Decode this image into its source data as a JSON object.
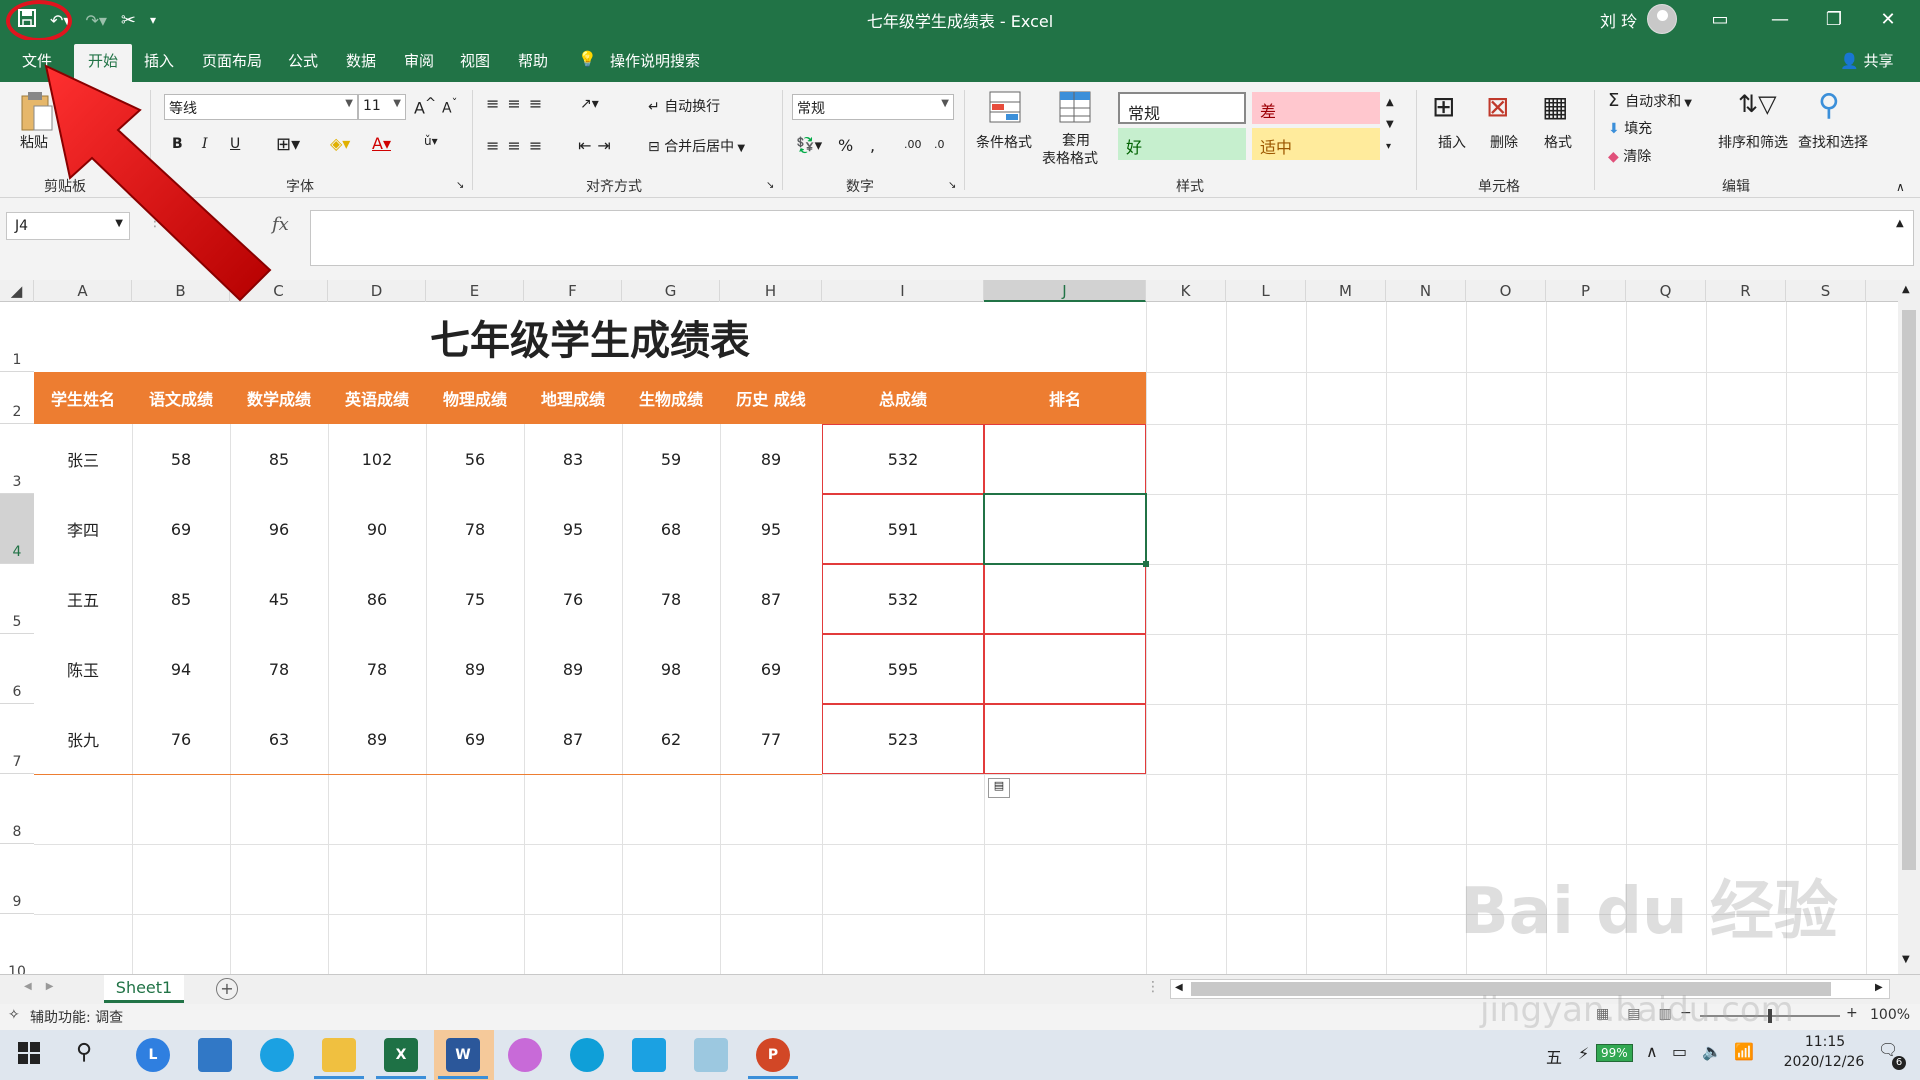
{
  "window": {
    "title": "七年级学生成绩表 - Excel",
    "user": "刘 玲"
  },
  "tabs": [
    "文件",
    "开始",
    "插入",
    "页面布局",
    "公式",
    "数据",
    "审阅",
    "视图",
    "帮助",
    "操作说明搜索"
  ],
  "active_tab": "开始",
  "share_label": "共享",
  "ribbon": {
    "clipboard": {
      "paste": "粘贴",
      "label": "剪贴板"
    },
    "font": {
      "name": "等线",
      "size": "11",
      "label": "字体",
      "bold": "B",
      "italic": "I",
      "underline": "U"
    },
    "align": {
      "wrap": "自动换行",
      "merge": "合并后居中",
      "label": "对齐方式"
    },
    "number": {
      "format": "常规",
      "percent": "%",
      "label": "数字"
    },
    "styles": {
      "conditional": "条件格式",
      "table_line1": "套用",
      "table_line2": "表格格式",
      "normal": "常规",
      "bad": "差",
      "good": "好",
      "neutral": "适中",
      "label": "样式"
    },
    "cells": {
      "insert": "插入",
      "delete": "删除",
      "format": "格式",
      "label": "单元格"
    },
    "editing": {
      "autosum": "自动求和",
      "fill": "填充",
      "clear": "清除",
      "sort": "排序和筛选",
      "find": "查找和选择",
      "label": "编辑"
    }
  },
  "namebox": "J4",
  "fx": "fx",
  "columns": [
    "A",
    "B",
    "C",
    "D",
    "E",
    "F",
    "G",
    "H",
    "I",
    "J",
    "K",
    "L",
    "M",
    "N",
    "O",
    "P",
    "Q",
    "R",
    "S"
  ],
  "rows": [
    "1",
    "2",
    "3",
    "4",
    "5",
    "6",
    "7",
    "8",
    "9",
    "10"
  ],
  "sheet": {
    "title": "七年级学生成绩表",
    "headers": [
      "学生姓名",
      "语文成绩",
      "数学成绩",
      "英语成绩",
      "物理成绩",
      "地理成绩",
      "生物成绩",
      "历史 成线",
      "总成绩",
      "排名"
    ],
    "data": [
      [
        "张三",
        "58",
        "85",
        "102",
        "56",
        "83",
        "59",
        "89",
        "532",
        ""
      ],
      [
        "李四",
        "69",
        "96",
        "90",
        "78",
        "95",
        "68",
        "95",
        "591",
        ""
      ],
      [
        "王五",
        "85",
        "45",
        "86",
        "75",
        "76",
        "78",
        "87",
        "532",
        ""
      ],
      [
        "陈玉",
        "94",
        "78",
        "78",
        "89",
        "89",
        "98",
        "69",
        "595",
        ""
      ],
      [
        "张九",
        "76",
        "63",
        "89",
        "69",
        "87",
        "62",
        "77",
        "523",
        ""
      ]
    ]
  },
  "sheet_tab": "Sheet1",
  "status": {
    "accessibility": "辅助功能: 调查",
    "zoom": "100%"
  },
  "taskbar": {
    "time": "11:15",
    "date": "2020/12/26",
    "battery": "99%",
    "ime": "五",
    "notifications": "6"
  },
  "watermark": {
    "text": "Bai du 经验",
    "sub": "jingyan.baidu.com"
  },
  "colors": {
    "excel_green": "#217346",
    "header_orange": "#ed7d31",
    "highlight_red": "#e23b3b",
    "bad_bg": "#ffc7ce",
    "good_bg": "#c6efce",
    "neutral_bg": "#ffeb9c"
  }
}
